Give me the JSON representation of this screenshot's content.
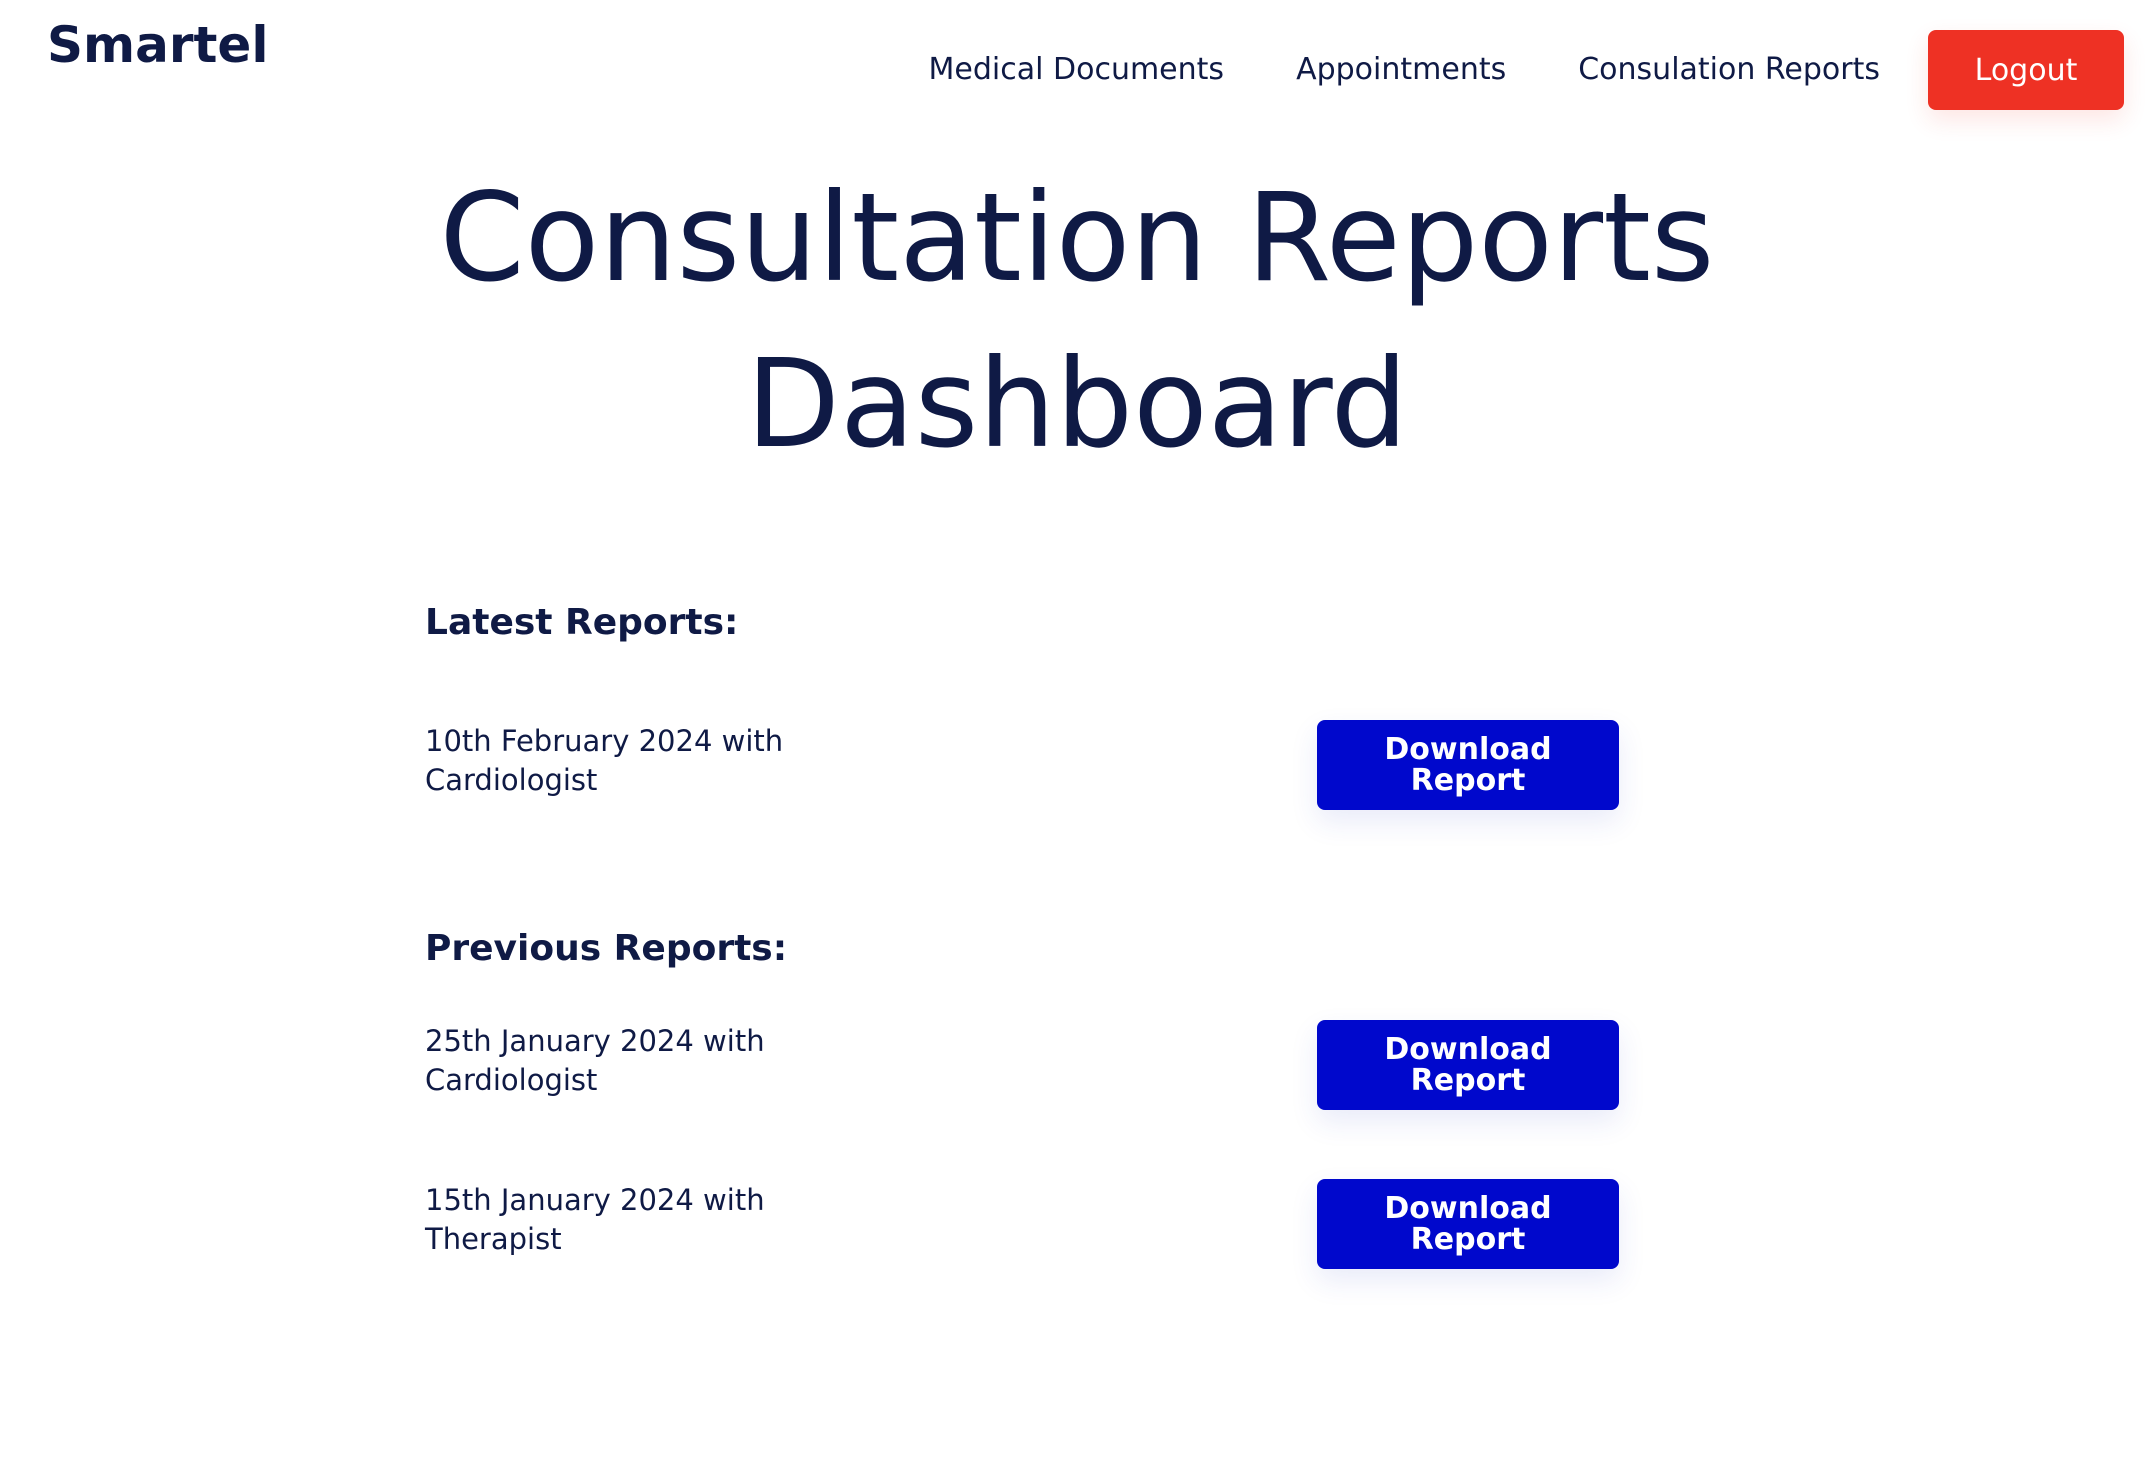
{
  "header": {
    "logo": "Smartel",
    "nav": [
      {
        "label": "Medical Documents"
      },
      {
        "label": "Appointments"
      },
      {
        "label": "Consulation Reports"
      }
    ],
    "logout_label": "Logout"
  },
  "main": {
    "title_line1": "Consultation Reports",
    "title_line2": "Dashboard",
    "latest": {
      "heading": "Latest Reports:",
      "items": [
        {
          "line1": "10th February 2024 with",
          "line2": "Cardiologist",
          "button": "Download Report"
        }
      ]
    },
    "previous": {
      "heading": "Previous Reports:",
      "items": [
        {
          "line1": "25th January 2024 with",
          "line2": "Cardiologist",
          "button": "Download Report"
        },
        {
          "line1": "15th January 2024 with",
          "line2": "Therapist",
          "button": "Download Report"
        }
      ]
    }
  },
  "colors": {
    "text": "#0f1a45",
    "logout": "#ee3124",
    "download": "#0008cc"
  }
}
